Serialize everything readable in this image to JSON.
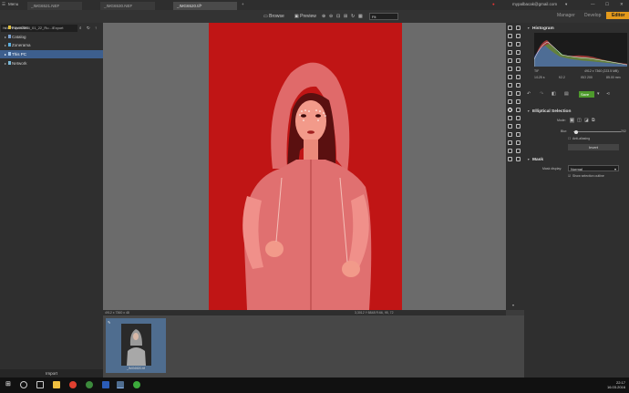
{
  "app": {
    "menu_label": "Menu",
    "tabs": [
      {
        "label": "_IMG6521.NEF"
      },
      {
        "label": "_IMG6530.NEF"
      },
      {
        "label": "_IMG6520.tif*"
      }
    ],
    "user_email": "mypalbacak@gmail.com",
    "account_caret": "▾"
  },
  "modes": {
    "manager": "Manager",
    "develop": "Develop",
    "editor": "Editor"
  },
  "toolbar": {
    "browse": "Browse",
    "preview": "Preview",
    "fit": "Fit"
  },
  "navigator": {
    "path": "H:\\#People\\2014_01_22_Ru...\\Export",
    "items": [
      {
        "label": "Favorites"
      },
      {
        "label": "Catalog"
      },
      {
        "label": "Zonerama"
      },
      {
        "label": "This PC"
      },
      {
        "label": "Network"
      }
    ],
    "import_label": "Import"
  },
  "status": {
    "left": "4912 x 7360 x 48",
    "right": "3,3012 Y:5848   R:66, 95, 72"
  },
  "filmstrip": {
    "items": [
      {
        "name": "_IMG6520.tif"
      }
    ]
  },
  "histogram": {
    "title": "Histogram",
    "format": "TIF",
    "dimensions": "4912 x 7360 (223.5 MB)",
    "shutter": "1/125 s",
    "aperture": "f/2.2",
    "iso": "ISO 200",
    "focal": "85.00 mm",
    "save_label": "Save"
  },
  "selection": {
    "title": "Elliptical Selection",
    "mode_label": "Mode:",
    "blur_label": "Blur:",
    "blur_value": "202",
    "blur_fraction": 0.05,
    "antialias_label": "Anti-aliasing",
    "invert_label": "Invert"
  },
  "mask": {
    "title": "Mask",
    "display_label": "Mask display:",
    "display_value": "Normal",
    "outline_label": "Show selection outline"
  },
  "taskbar": {
    "time": "22:17",
    "date": "16.03.2016"
  },
  "colors": {
    "accent": "#e49a1c",
    "selection": "#3d5f8e",
    "mask_red": "#d21a1a",
    "save_green": "#4e9a2c"
  }
}
